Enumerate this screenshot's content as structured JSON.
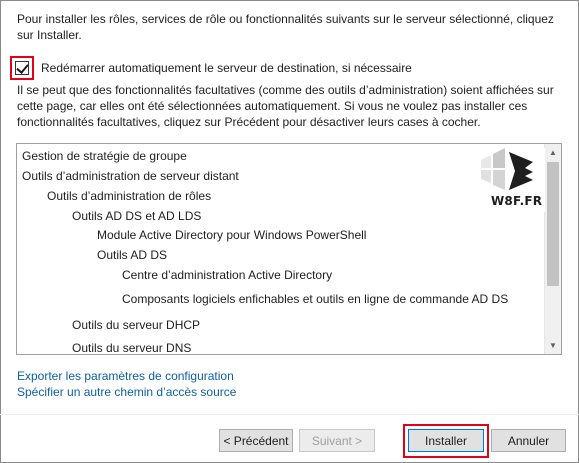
{
  "intro_text": "Pour installer les rôles, services de rôle ou fonctionnalités suivants sur le serveur sélectionné, cliquez sur Installer.",
  "restart_checkbox": {
    "label": "Redémarrer automatiquement le serveur de destination, si nécessaire",
    "checked": true
  },
  "note_text": "Il se peut que des fonctionnalités facultatives (comme des outils d’administration) soient affichées sur cette page, car elles ont été sélectionnées automatiquement. Si vous ne voulez pas installer ces fonctionnalités facultatives, cliquez sur Précédent pour désactiver leurs cases à cocher.",
  "features": [
    "Gestion de stratégie de groupe",
    "Outils d’administration de serveur distant",
    "Outils d’administration de rôles",
    "Outils AD DS et AD LDS",
    "Module Active Directory pour Windows PowerShell",
    "Outils AD DS",
    "Centre d’administration Active Directory",
    "Composants logiciels enfichables et outils en ligne de commande AD DS",
    "Outils du serveur DHCP",
    "Outils du serveur DNS"
  ],
  "watermark_text": "W8F.FR",
  "links": {
    "export": "Exporter les paramètres de configuration",
    "source": "Spécifier un autre chemin d’accès source"
  },
  "buttons": {
    "previous": "< Précédent",
    "next": "Suivant >",
    "install": "Installer",
    "cancel": "Annuler"
  },
  "colors": {
    "highlight": "#e3001b",
    "link": "#0d5fa8"
  }
}
